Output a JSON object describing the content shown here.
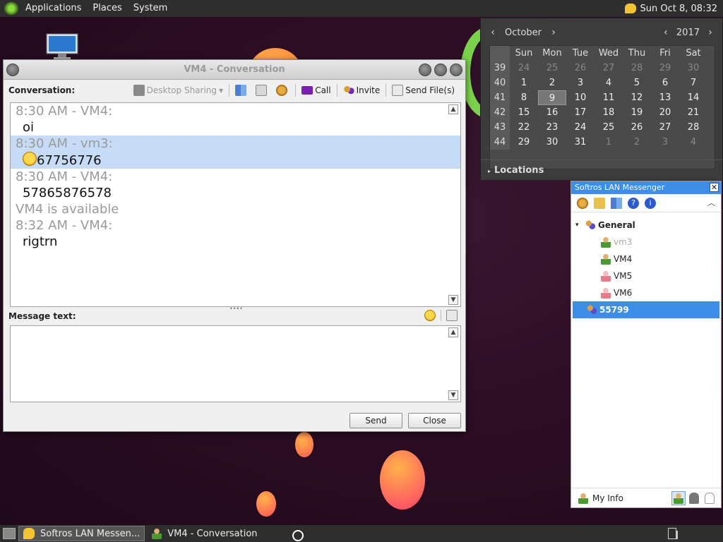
{
  "top_panel": {
    "menus": [
      "Applications",
      "Places",
      "System"
    ],
    "clock": "Sun Oct  8, 08:32"
  },
  "calendar": {
    "month": "October",
    "year": "2017",
    "weekdays": [
      "Sun",
      "Mon",
      "Tue",
      "Wed",
      "Thu",
      "Fri",
      "Sat"
    ],
    "weeks": [
      {
        "wk": "39",
        "days": [
          "24",
          "25",
          "26",
          "27",
          "28",
          "29",
          "30"
        ],
        "dim": [
          true,
          true,
          true,
          true,
          true,
          true,
          true
        ]
      },
      {
        "wk": "40",
        "days": [
          "1",
          "2",
          "3",
          "4",
          "5",
          "6",
          "7"
        ],
        "dim": [
          false,
          false,
          false,
          false,
          false,
          false,
          false
        ]
      },
      {
        "wk": "41",
        "days": [
          "8",
          "9",
          "10",
          "11",
          "12",
          "13",
          "14"
        ],
        "dim": [
          false,
          false,
          false,
          false,
          false,
          false,
          false
        ]
      },
      {
        "wk": "42",
        "days": [
          "15",
          "16",
          "17",
          "18",
          "19",
          "20",
          "21"
        ],
        "dim": [
          false,
          false,
          false,
          false,
          false,
          false,
          false
        ]
      },
      {
        "wk": "43",
        "days": [
          "22",
          "23",
          "24",
          "25",
          "26",
          "27",
          "28"
        ],
        "dim": [
          false,
          false,
          false,
          false,
          false,
          false,
          false
        ]
      },
      {
        "wk": "44",
        "days": [
          "29",
          "30",
          "31",
          "1",
          "2",
          "3",
          "4"
        ],
        "dim": [
          false,
          false,
          false,
          true,
          true,
          true,
          true
        ]
      }
    ],
    "today": "9",
    "locations_label": "Locations"
  },
  "conversation": {
    "title": "VM4 - Conversation",
    "label": "Conversation:",
    "toolbar": {
      "desktop_sharing": "Desktop Sharing",
      "call": "Call",
      "invite": "Invite",
      "send_files": "Send File(s)"
    },
    "messages": [
      {
        "header": "8:30 AM - VM4:",
        "text": "oi",
        "selected": false,
        "emoji": false
      },
      {
        "header": "8:30 AM - vm3:",
        "text": "67756776",
        "selected": true,
        "emoji": true
      },
      {
        "header": "8:30 AM - VM4:",
        "text": "57865876578",
        "selected": false,
        "emoji": false
      }
    ],
    "status_line": "VM4 is available",
    "last_message": {
      "header": "8:32 AM - VM4:",
      "text": "rigtrn"
    },
    "message_text_label": "Message text:",
    "send_label": "Send",
    "close_label": "Close"
  },
  "lan_messenger": {
    "title": "Softros LAN Messenger",
    "groups": [
      {
        "name": "General",
        "users": [
          {
            "name": "vm3",
            "status": "online-self",
            "greyed": true
          },
          {
            "name": "VM4",
            "status": "online",
            "greyed": false
          },
          {
            "name": "VM5",
            "status": "offline",
            "greyed": false
          },
          {
            "name": "VM6",
            "status": "offline",
            "greyed": false
          }
        ]
      }
    ],
    "selected_group": "55799",
    "my_info_label": "My Info"
  },
  "taskbar": {
    "tasks": [
      {
        "label": "Softros LAN Messen...",
        "active": true
      },
      {
        "label": "VM4 - Conversation",
        "active": false
      }
    ]
  },
  "colors": {
    "accent_blue": "#3d8ee8",
    "selection": "#c6dcf6",
    "panel": "#2e2e2e"
  }
}
